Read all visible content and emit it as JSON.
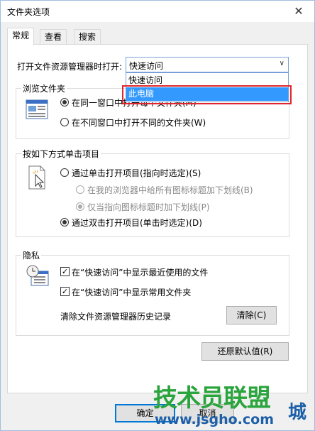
{
  "window": {
    "title": "文件夹选项",
    "close_glyph": "✕"
  },
  "tabs": [
    "常规",
    "查看",
    "搜索"
  ],
  "open_explorer": {
    "label": "打开文件资源管理器时打开:",
    "selected_value": "快速访问",
    "options": [
      "快速访问",
      "此电脑"
    ],
    "highlighted_option": "此电脑"
  },
  "browse_folders": {
    "title": "浏览文件夹",
    "option_same_window": "在同一窗口中打开每个文件夹(M)",
    "option_new_window": "在不同窗口中打开不同的文件夹(W)",
    "selected": "same_window"
  },
  "click_items": {
    "title": "按如下方式单击项目",
    "option_single": "通过单击打开项目(指向时选定)(S)",
    "sub_underline_browser": "在我的浏览器中给所有图标标题加下划线(B)",
    "sub_underline_point": "仅当指向图标标题时加下划线(P)",
    "option_double": "通过双击打开项目(单击时选定)(D)",
    "selected": "double"
  },
  "privacy": {
    "title": "隐私",
    "show_recent_files": "在“快速访问”中显示最近使用的文件",
    "show_frequent_folders": "在“快速访问”中显示常用文件夹",
    "recent_checked": true,
    "frequent_checked": true,
    "clear_history_label": "清除文件资源管理器历史记录",
    "clear_button": "清除(C)"
  },
  "restore_defaults_button": "还原默认值(R)",
  "footer": {
    "ok_button": "确定",
    "cancel_button": "取消"
  },
  "watermark": {
    "text_cn": "技术员联盟",
    "text_url": "www.jsgho.com",
    "text_tail": "城"
  },
  "colors": {
    "selection_blue": "#3399ff",
    "highlight_red": "#e0262d",
    "watermark_green": "#2aa43c",
    "watermark_blue": "#1d5fa8"
  }
}
